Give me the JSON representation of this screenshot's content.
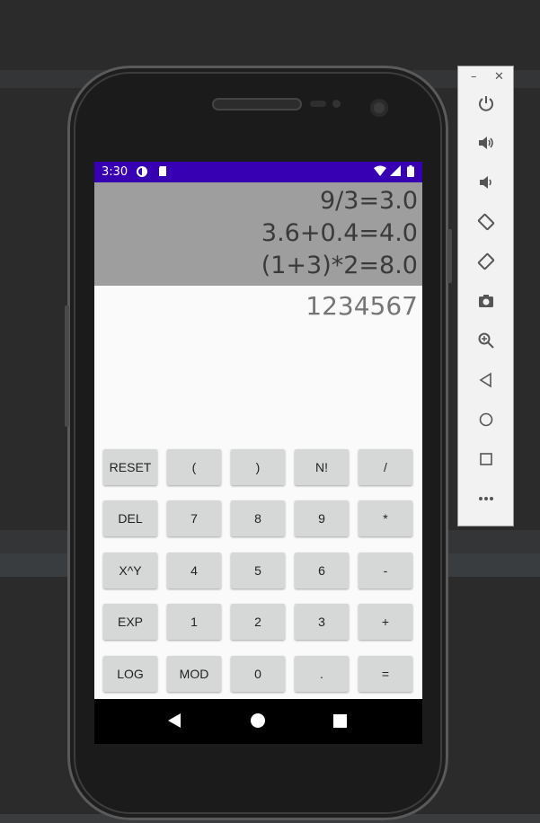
{
  "status_bar": {
    "time": "3:30"
  },
  "history": [
    "9/3=3.0",
    "3.6+0.4=4.0",
    "(1+3)*2=8.0"
  ],
  "current_input": "1234567",
  "keypad": [
    [
      "RESET",
      "(",
      ")",
      "N!",
      "/"
    ],
    [
      "DEL",
      "7",
      "8",
      "9",
      "*"
    ],
    [
      "X^Y",
      "4",
      "5",
      "6",
      "-"
    ],
    [
      "EXP",
      "1",
      "2",
      "3",
      "+"
    ],
    [
      "LOG",
      "MOD",
      "0",
      ".",
      "="
    ]
  ],
  "emulator_toolbar": {
    "window_controls": [
      "minimize-icon",
      "close-icon"
    ],
    "buttons": [
      "power-icon",
      "volume-up-icon",
      "volume-down-icon",
      "rotate-left-icon",
      "rotate-right-icon",
      "camera-icon",
      "zoom-icon",
      "back-icon",
      "home-icon",
      "overview-icon",
      "more-icon"
    ]
  },
  "colors": {
    "status_bar": "#3700b3",
    "history_bg": "#9e9e9e",
    "key_bg": "#d6d7d7"
  }
}
